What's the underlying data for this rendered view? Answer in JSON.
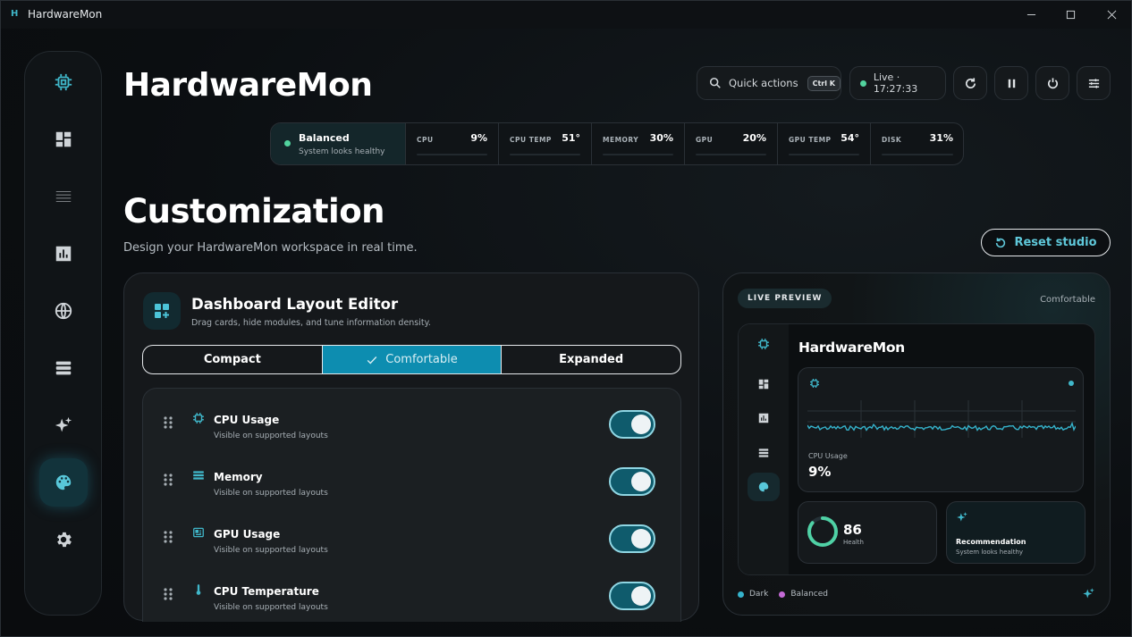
{
  "window": {
    "title": "HardwareMon",
    "app_icon": "H"
  },
  "sidebar": {
    "items": [
      {
        "name": "chip-icon"
      },
      {
        "name": "dashboard-icon"
      },
      {
        "name": "list-icon"
      },
      {
        "name": "chart-icon"
      },
      {
        "name": "globe-icon"
      },
      {
        "name": "storage-icon"
      },
      {
        "name": "sparkles-icon"
      },
      {
        "name": "palette-icon",
        "active": true
      },
      {
        "name": "gear-icon"
      }
    ]
  },
  "header": {
    "app_title": "HardwareMon",
    "quick_actions_label": "Quick actions",
    "quick_actions_shortcut": "Ctrl K",
    "live_label": "Live · 17:27:33"
  },
  "status": {
    "state": "Balanced",
    "state_sub": "System looks healthy",
    "metrics": [
      {
        "name": "CPU",
        "value": "9%"
      },
      {
        "name": "CPU TEMP",
        "value": "51°"
      },
      {
        "name": "MEMORY",
        "value": "30%"
      },
      {
        "name": "GPU",
        "value": "20%"
      },
      {
        "name": "GPU TEMP",
        "value": "54°"
      },
      {
        "name": "DISK",
        "value": "31%"
      }
    ]
  },
  "page": {
    "title": "Customization",
    "subtitle": "Design your HardwareMon workspace in real time.",
    "reset_label": "Reset studio"
  },
  "editor": {
    "title": "Dashboard Layout Editor",
    "subtitle": "Drag cards, hide modules, and tune information density.",
    "density_options": [
      "Compact",
      "Comfortable",
      "Expanded"
    ],
    "density_selected": "Comfortable",
    "modules": [
      {
        "title": "CPU Usage",
        "sub": "Visible on supported layouts",
        "enabled": true,
        "icon": "chip-icon"
      },
      {
        "title": "Memory",
        "sub": "Visible on supported layouts",
        "enabled": true,
        "icon": "memory-icon"
      },
      {
        "title": "GPU Usage",
        "sub": "Visible on supported layouts",
        "enabled": true,
        "icon": "gpu-icon"
      },
      {
        "title": "CPU Temperature",
        "sub": "Visible on supported layouts",
        "enabled": true,
        "icon": "thermometer-icon"
      }
    ]
  },
  "preview": {
    "badge": "LIVE PREVIEW",
    "density": "Comfortable",
    "app_title": "HardwareMon",
    "cpu_label": "CPU Usage",
    "cpu_value": "9%",
    "health_value": "86",
    "health_label": "Health",
    "health_fraction": 0.86,
    "rec_title": "Recommendation",
    "rec_sub": "System looks healthy",
    "legend": [
      {
        "label": "Dark",
        "color": "#35b3cc"
      },
      {
        "label": "Balanced",
        "color": "#c46ad6"
      }
    ]
  },
  "colors": {
    "accent": "#0d8db0",
    "accent_light": "#40b7ca",
    "live_dot": "#52d39e"
  }
}
